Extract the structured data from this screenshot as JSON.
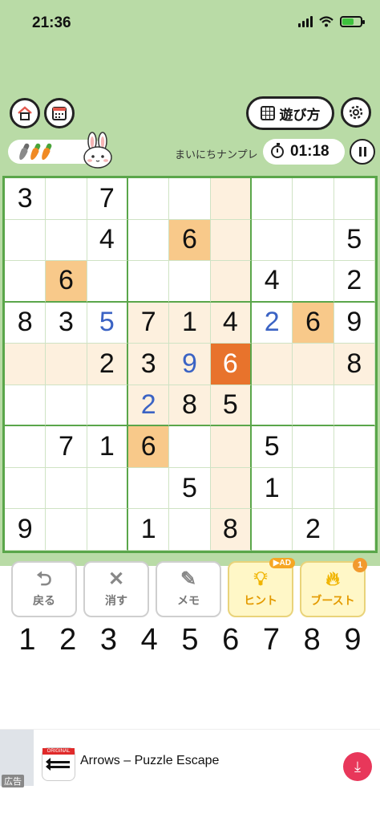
{
  "status_bar": {
    "time": "21:36"
  },
  "header": {
    "howto_label": "遊び方",
    "daily_label": "まいにちナンプレ",
    "timer": "01:18"
  },
  "board": {
    "rows": [
      [
        "3",
        "",
        "7",
        "",
        "",
        "",
        "",
        "",
        ""
      ],
      [
        "",
        "",
        "4",
        "",
        "6",
        "",
        "",
        "",
        "5"
      ],
      [
        "",
        "6",
        "",
        "",
        "",
        "",
        "4",
        "",
        "2"
      ],
      [
        "8",
        "3",
        "5",
        "7",
        "1",
        "4",
        "2",
        "6",
        "9"
      ],
      [
        "",
        "",
        "2",
        "3",
        "9",
        "6",
        "",
        "",
        "8"
      ],
      [
        "",
        "",
        "",
        "2",
        "8",
        "5",
        "",
        "",
        ""
      ],
      [
        "",
        "7",
        "1",
        "6",
        "",
        "",
        "5",
        "",
        ""
      ],
      [
        "",
        "",
        "",
        "",
        "5",
        "",
        "1",
        "",
        ""
      ],
      [
        "9",
        "",
        "",
        "1",
        "",
        "8",
        "",
        "2",
        ""
      ]
    ],
    "user_entered": [
      [
        3,
        2
      ],
      [
        3,
        6
      ],
      [
        4,
        4
      ],
      [
        5,
        3
      ]
    ],
    "selected": [
      4,
      5
    ],
    "colors": {
      "grid": "#5aa64a",
      "highlight": "#fdf0de",
      "same_number": "#f8c98a",
      "selected": "#e8732c",
      "user_number": "#3b63c4"
    }
  },
  "actions": [
    {
      "label": "戻る",
      "icon": "undo-icon"
    },
    {
      "label": "消す",
      "icon": "erase-icon"
    },
    {
      "label": "メモ",
      "icon": "pencil-icon"
    },
    {
      "label": "ヒント",
      "icon": "lightbulb-icon",
      "badge": "▶AD"
    },
    {
      "label": "ブースト",
      "icon": "flame-icon",
      "badge": "1"
    }
  ],
  "numpad": [
    "1",
    "2",
    "3",
    "4",
    "5",
    "6",
    "7",
    "8",
    "9"
  ],
  "ad": {
    "label": "広告",
    "title": "Arrows – Puzzle Escape",
    "icon_badge": "ORIGINAL"
  }
}
